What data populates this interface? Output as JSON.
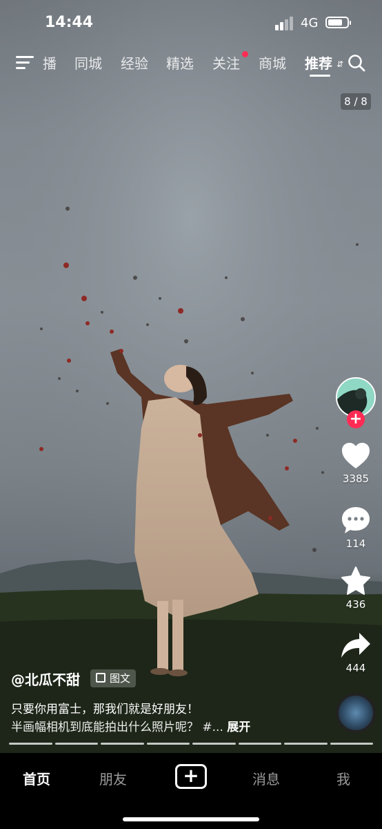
{
  "status_bar": {
    "time": "14:44",
    "network": "4G",
    "battery_level": 0.75
  },
  "top_nav": {
    "tabs": [
      {
        "label": "播"
      },
      {
        "label": "同城"
      },
      {
        "label": "经验"
      },
      {
        "label": "精选"
      },
      {
        "label": "关注",
        "has_dot": true
      },
      {
        "label": "商城"
      },
      {
        "label": "推荐",
        "active": true
      }
    ],
    "icons": [
      "menu-icon",
      "search-icon"
    ]
  },
  "page_counter": "8 / 8",
  "actions": {
    "likes": "3385",
    "comments": "114",
    "favorites": "436",
    "shares": "444",
    "follow_symbol": "+"
  },
  "post": {
    "author": "@北瓜不甜",
    "type_badge": "图文",
    "caption_line1": "只要你用富士，那我们就是好朋友！",
    "caption_line2": "半画幅相机到底能拍出什么照片呢？ #...",
    "expand_label": "展开",
    "image_count": 8,
    "current_image": 8
  },
  "bottom_tabs": {
    "home": "首页",
    "friends": "朋友",
    "create": "+",
    "messages": "消息",
    "me": "我"
  },
  "colors": {
    "accent_red": "#fe2c55",
    "tab_bar_bg": "#000000"
  }
}
